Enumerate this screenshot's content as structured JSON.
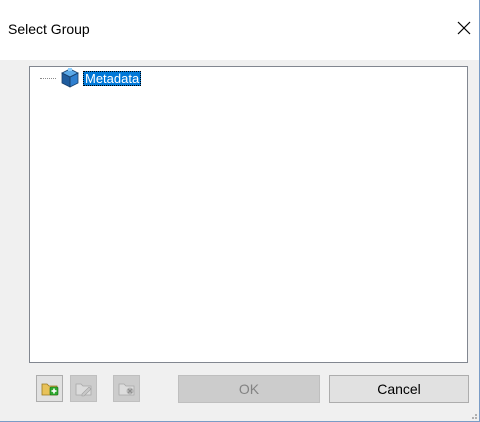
{
  "dialog": {
    "title": "Select Group",
    "close_icon": "close-icon"
  },
  "tree": {
    "root": {
      "label": "Metadata",
      "icon": "metadata-group-icon",
      "selected": true
    }
  },
  "toolbar": {
    "buttons": [
      {
        "icon": "add-folder-icon",
        "enabled": true
      },
      {
        "icon": "edit-folder-icon",
        "enabled": false
      },
      {
        "icon": "delete-folder-icon",
        "enabled": false
      }
    ]
  },
  "actions": {
    "ok_label": "OK",
    "ok_enabled": false,
    "cancel_label": "Cancel"
  },
  "colors": {
    "selection": "#0078d7",
    "folder": "#e8c25a",
    "add_green": "#2eaa2e"
  }
}
